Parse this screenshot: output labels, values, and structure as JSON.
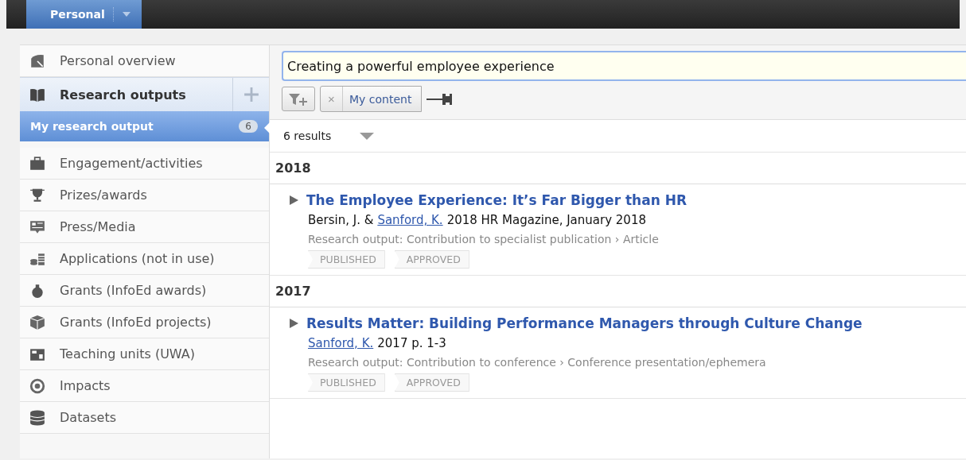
{
  "top_bar": {
    "tab": {
      "label": "Personal",
      "selected": true
    }
  },
  "sidebar": {
    "items": [
      {
        "kind": "item",
        "label": "Personal overview",
        "selected": false
      },
      {
        "kind": "section",
        "label": "Research outputs",
        "selected": false
      },
      {
        "kind": "sub",
        "label": "My research output",
        "count": "6",
        "selected": true
      },
      {
        "kind": "item",
        "label": "Engagement/activities",
        "selected": false
      },
      {
        "kind": "item",
        "label": "Prizes/awards",
        "selected": false
      },
      {
        "kind": "item",
        "label": "Press/Media",
        "selected": false
      },
      {
        "kind": "item",
        "label": "Applications (not in use)",
        "selected": false
      },
      {
        "kind": "item",
        "label": "Grants (InfoEd awards)",
        "selected": false
      },
      {
        "kind": "item",
        "label": "Grants (InfoEd projects)",
        "selected": false
      },
      {
        "kind": "item",
        "label": "Teaching units (UWA)",
        "selected": false
      },
      {
        "kind": "item",
        "label": "Impacts",
        "selected": false
      },
      {
        "kind": "item",
        "label": "Datasets",
        "selected": false
      }
    ]
  },
  "search": {
    "value": "Creating a powerful employee experience"
  },
  "filter": {
    "remove": "×",
    "chip": "My content"
  },
  "results": {
    "count": "6 results",
    "groups": [
      {
        "year": "2018",
        "items": [
          {
            "title": "The Employee Experience: It’s Far Bigger than HR",
            "byline": [
              {
                "text": "Bersin, J. &",
                "link": false
              },
              {
                "text": "Sanford, K.",
                "link": true
              },
              {
                "text": "2018 HR Magazine, January 2018",
                "link": false
              }
            ],
            "type": "Research output: Contribution to specialist publication › Article",
            "tags": [
              "PUBLISHED",
              "APPROVED"
            ]
          }
        ]
      },
      {
        "year": "2017",
        "items": [
          {
            "title": "Results Matter: Building Performance Managers through Culture Change",
            "byline": [
              {
                "text": "Sanford, K.",
                "link": true
              },
              {
                "text": "2017 p. 1-3",
                "link": false
              }
            ],
            "type": "Research output: Contribution to conference › Conference presentation/ephemera",
            "tags": [
              "PUBLISHED",
              "APPROVED"
            ]
          }
        ]
      }
    ]
  }
}
